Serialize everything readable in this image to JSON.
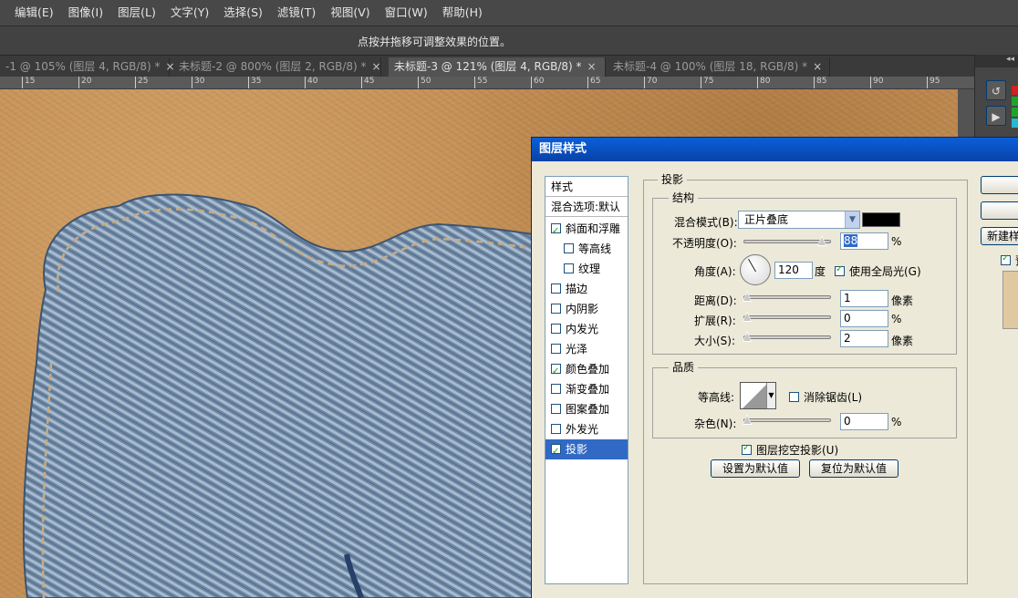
{
  "menu": [
    "编辑(E)",
    "图像(I)",
    "图层(L)",
    "文字(Y)",
    "选择(S)",
    "滤镜(T)",
    "视图(V)",
    "窗口(W)",
    "帮助(H)"
  ],
  "options_bar": {
    "hint": "点按并拖移可调整效果的位置。"
  },
  "tabs": [
    {
      "label": "-1 @ 105% (图层 4, RGB/8) *",
      "close": "×"
    },
    {
      "label": "未标题-2 @ 800% (图层 2, RGB/8) *",
      "close": "×"
    },
    {
      "label": "未标题-3 @ 121% (图层 4, RGB/8) *",
      "close": "×"
    },
    {
      "label": "未标题-4 @ 100% (图层 18, RGB/8) *",
      "close": "×"
    }
  ],
  "ruler": [
    "15",
    "20",
    "25",
    "30",
    "35",
    "40",
    "45",
    "50",
    "55",
    "60",
    "65",
    "70",
    "75",
    "80",
    "85",
    "90",
    "95"
  ],
  "panel_header": "◂◂",
  "dialog": {
    "title": "图层样式",
    "style_list": {
      "header": "样式",
      "blend": "混合选项:默认",
      "items": [
        {
          "label": "斜面和浮雕",
          "checked": true
        },
        {
          "label": "等高线",
          "checked": false
        },
        {
          "label": "纹理",
          "checked": false
        },
        {
          "label": "描边",
          "checked": false
        },
        {
          "label": "内阴影",
          "checked": false
        },
        {
          "label": "内发光",
          "checked": false
        },
        {
          "label": "光泽",
          "checked": false
        },
        {
          "label": "颜色叠加",
          "checked": true
        },
        {
          "label": "渐变叠加",
          "checked": false
        },
        {
          "label": "图案叠加",
          "checked": false
        },
        {
          "label": "外发光",
          "checked": false
        },
        {
          "label": "投影",
          "checked": true,
          "selected": true
        }
      ]
    },
    "section_title": "投影",
    "structure": {
      "title": "结构",
      "blend_mode_label": "混合模式(B):",
      "blend_mode_value": "正片叠底",
      "opacity_label": "不透明度(O):",
      "opacity_value": "88",
      "percent": "%",
      "angle_label": "角度(A):",
      "angle_value": "120",
      "degree": "度",
      "global_light_label": "使用全局光(G)",
      "distance_label": "距离(D):",
      "distance_value": "1",
      "spread_label": "扩展(R):",
      "spread_value": "0",
      "size_label": "大小(S):",
      "size_value": "2",
      "pixel": "像素"
    },
    "quality": {
      "title": "品质",
      "contour_label": "等高线:",
      "anti_alias_label": "消除锯齿(L)",
      "noise_label": "杂色(N):",
      "noise_value": "0",
      "percent": "%"
    },
    "knockout_label": "图层挖空投影(U)",
    "set_default": "设置为默认值",
    "reset_default": "复位为默认值",
    "new_style": "新建样",
    "preview_label": "预"
  }
}
